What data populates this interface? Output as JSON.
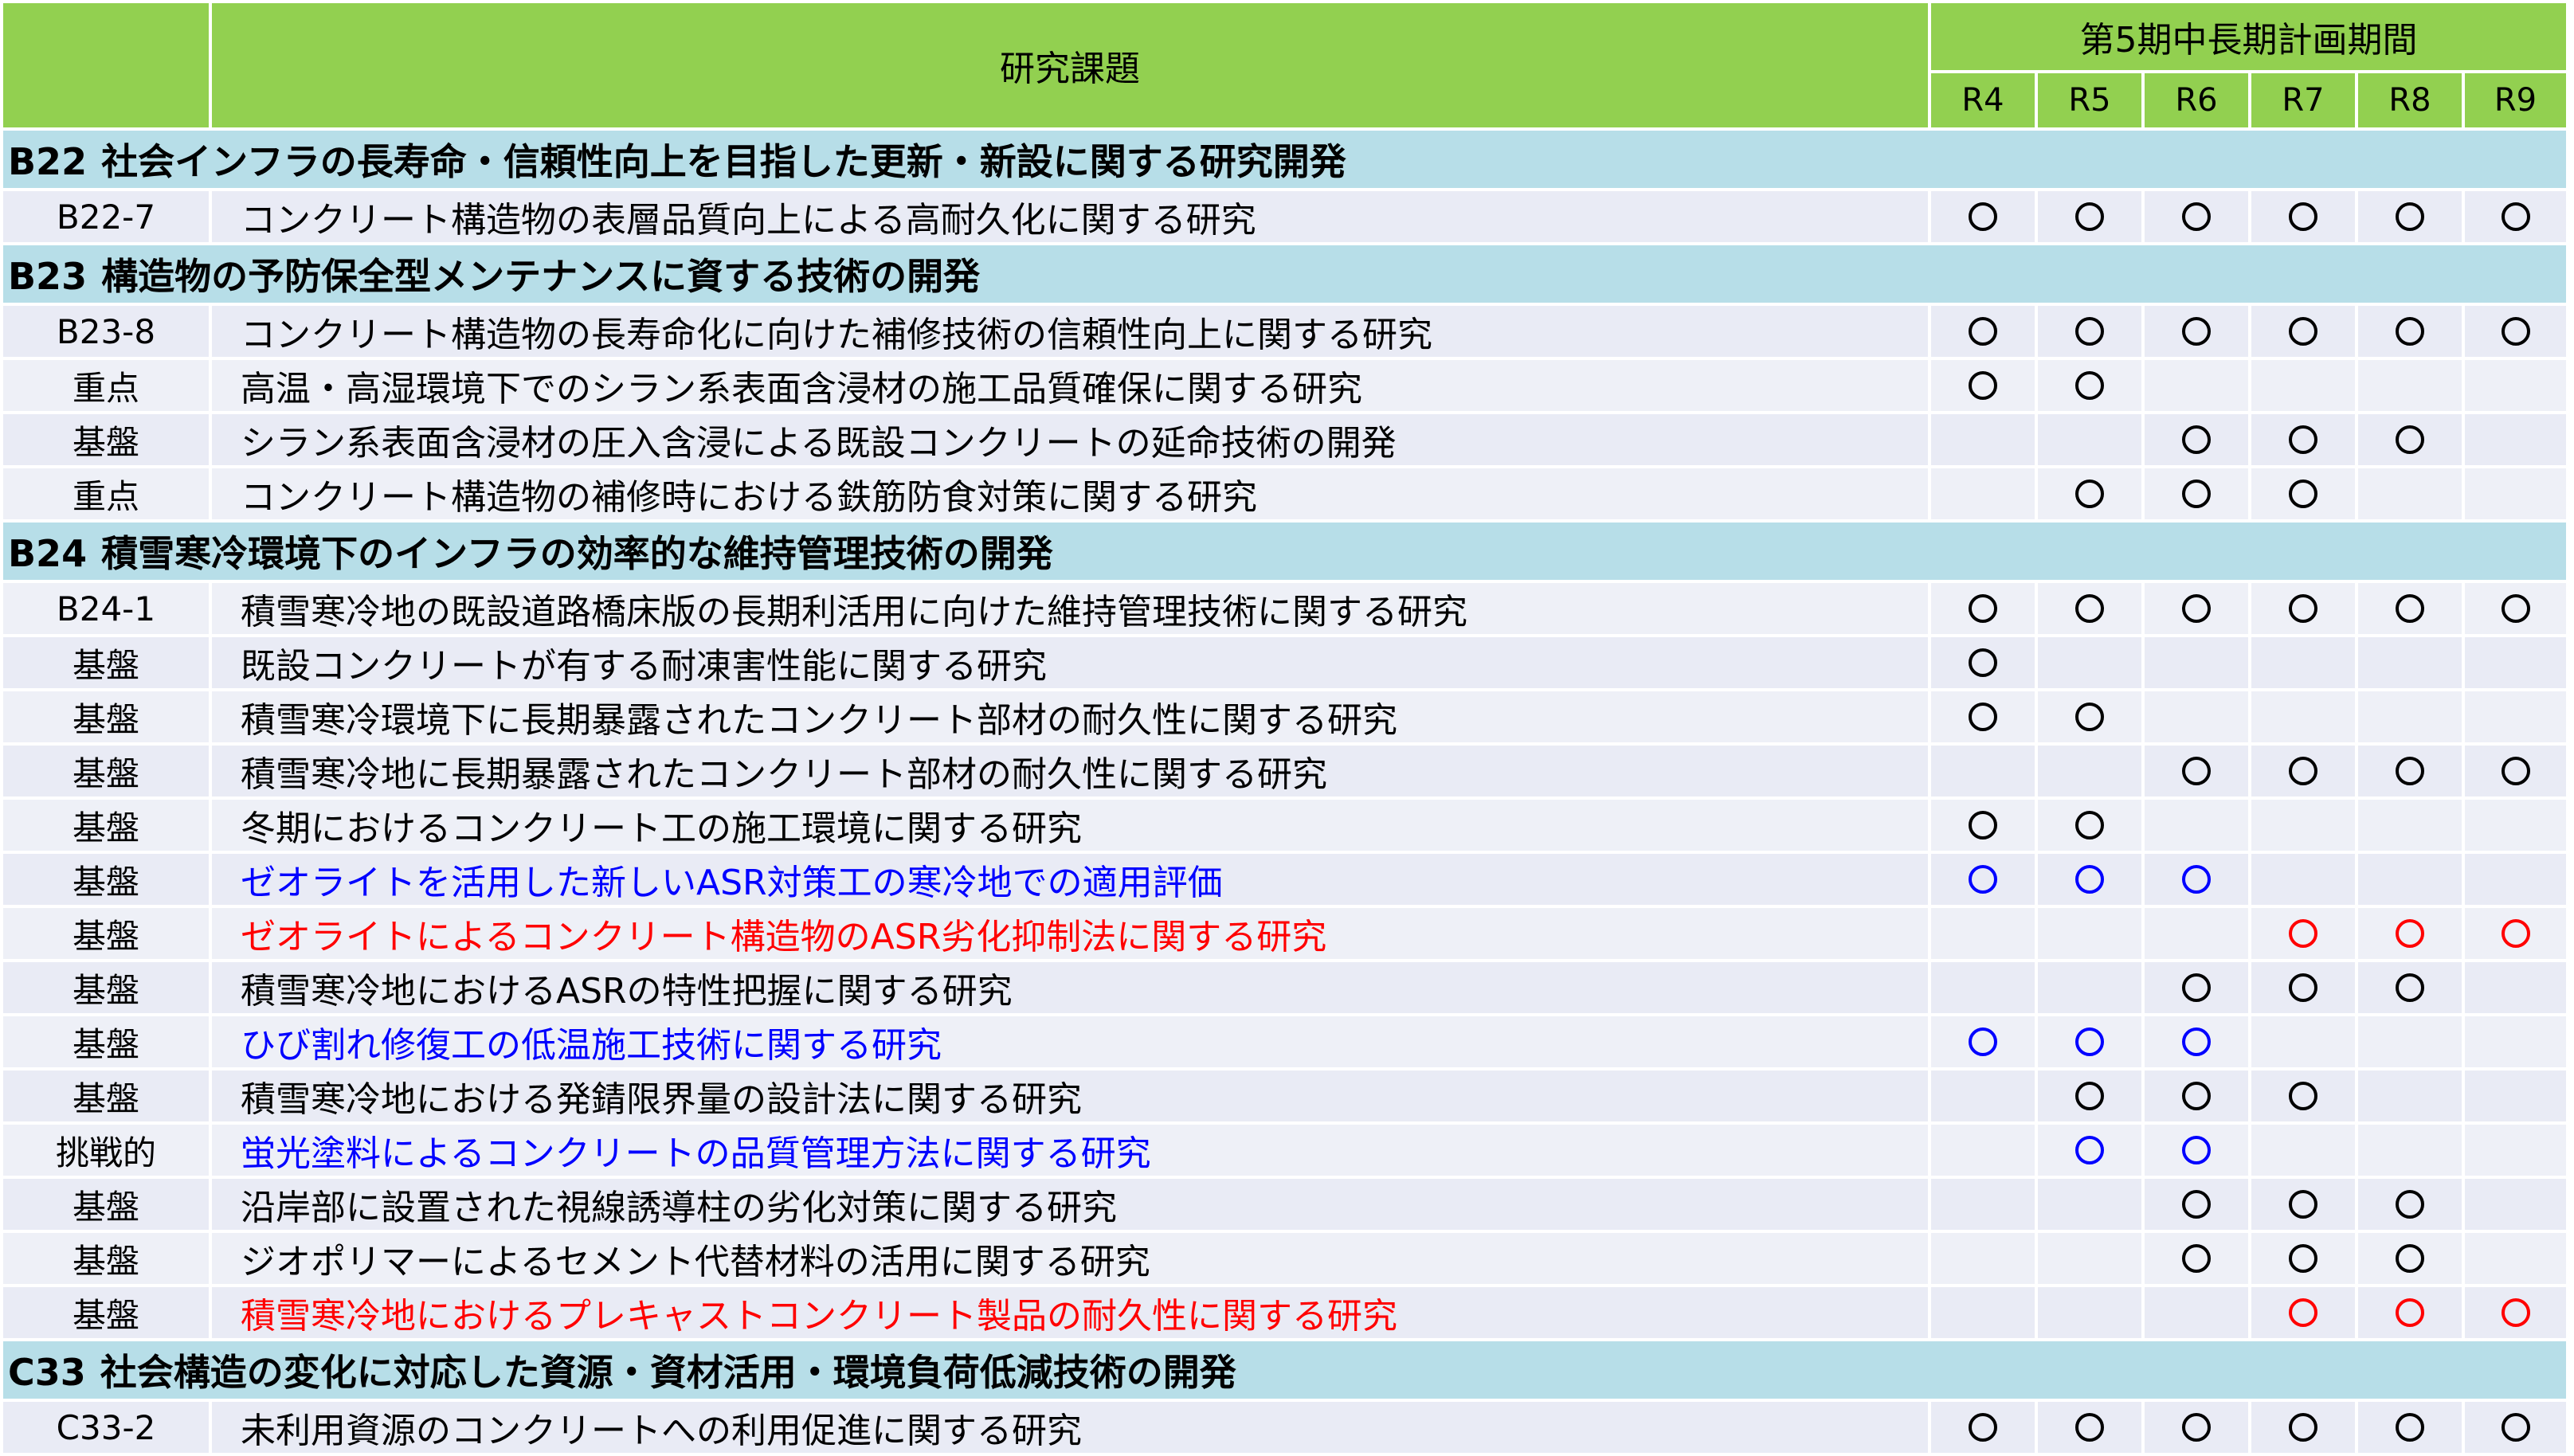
{
  "header": {
    "title": "研究課題",
    "period": "第5期中長期計画期間",
    "years": [
      "R4",
      "R5",
      "R6",
      "R7",
      "R8",
      "R9"
    ]
  },
  "groups": [
    {
      "code": "B22",
      "title": "社会インフラの長寿命・信頼性向上を目指した更新・新設に関する研究開発",
      "rows": [
        {
          "code": "B22-7",
          "title": "コンクリート構造物の表層品質向上による高耐久化に関する研究",
          "color": "black",
          "marks": [
            1,
            1,
            1,
            1,
            1,
            1
          ]
        }
      ]
    },
    {
      "code": "B23",
      "title": "構造物の予防保全型メンテナンスに資する技術の開発",
      "rows": [
        {
          "code": "B23-8",
          "title": "コンクリート構造物の長寿命化に向けた補修技術の信頼性向上に関する研究",
          "color": "black",
          "marks": [
            1,
            1,
            1,
            1,
            1,
            1
          ]
        },
        {
          "code": "重点",
          "title": "高温・高湿環境下でのシラン系表面含浸材の施工品質確保に関する研究",
          "color": "black",
          "marks": [
            1,
            1,
            0,
            0,
            0,
            0
          ]
        },
        {
          "code": "基盤",
          "title": "シラン系表面含浸材の圧入含浸による既設コンクリートの延命技術の開発",
          "color": "black",
          "marks": [
            0,
            0,
            1,
            1,
            1,
            0
          ]
        },
        {
          "code": "重点",
          "title": "コンクリート構造物の補修時における鉄筋防食対策に関する研究",
          "color": "black",
          "marks": [
            0,
            1,
            1,
            1,
            0,
            0
          ]
        }
      ]
    },
    {
      "code": "B24",
      "title": "積雪寒冷環境下のインフラの効率的な維持管理技術の開発",
      "rows": [
        {
          "code": "B24-1",
          "title": "積雪寒冷地の既設道路橋床版の長期利活用に向けた維持管理技術に関する研究",
          "color": "black",
          "marks": [
            1,
            1,
            1,
            1,
            1,
            1
          ]
        },
        {
          "code": "基盤",
          "title": "既設コンクリートが有する耐凍害性能に関する研究",
          "color": "black",
          "marks": [
            1,
            0,
            0,
            0,
            0,
            0
          ]
        },
        {
          "code": "基盤",
          "title": "積雪寒冷環境下に長期暴露されたコンクリート部材の耐久性に関する研究",
          "color": "black",
          "marks": [
            1,
            1,
            0,
            0,
            0,
            0
          ]
        },
        {
          "code": "基盤",
          "title": "積雪寒冷地に長期暴露されたコンクリート部材の耐久性に関する研究",
          "color": "black",
          "marks": [
            0,
            0,
            1,
            1,
            1,
            1
          ]
        },
        {
          "code": "基盤",
          "title": "冬期におけるコンクリート工の施工環境に関する研究",
          "color": "black",
          "marks": [
            1,
            1,
            0,
            0,
            0,
            0
          ]
        },
        {
          "code": "基盤",
          "title": "ゼオライトを活用した新しいASR対策工の寒冷地での適用評価",
          "color": "blue",
          "marks": [
            1,
            1,
            1,
            0,
            0,
            0
          ]
        },
        {
          "code": "基盤",
          "title": "ゼオライトによるコンクリート構造物のASR劣化抑制法に関する研究",
          "color": "red",
          "marks": [
            0,
            0,
            0,
            1,
            1,
            1
          ]
        },
        {
          "code": "基盤",
          "title": "積雪寒冷地におけるASRの特性把握に関する研究",
          "color": "black",
          "marks": [
            0,
            0,
            1,
            1,
            1,
            0
          ]
        },
        {
          "code": "基盤",
          "title": "ひび割れ修復工の低温施工技術に関する研究",
          "color": "blue",
          "marks": [
            1,
            1,
            1,
            0,
            0,
            0
          ]
        },
        {
          "code": "基盤",
          "title": "積雪寒冷地における発錆限界量の設計法に関する研究",
          "color": "black",
          "marks": [
            0,
            1,
            1,
            1,
            0,
            0
          ]
        },
        {
          "code": "挑戦的",
          "title": "蛍光塗料によるコンクリートの品質管理方法に関する研究",
          "color": "blue",
          "marks": [
            0,
            1,
            1,
            0,
            0,
            0
          ]
        },
        {
          "code": "基盤",
          "title": "沿岸部に設置された視線誘導柱の劣化対策に関する研究",
          "color": "black",
          "marks": [
            0,
            0,
            1,
            1,
            1,
            0
          ]
        },
        {
          "code": "基盤",
          "title": "ジオポリマーによるセメント代替材料の活用に関する研究",
          "color": "black",
          "marks": [
            0,
            0,
            1,
            1,
            1,
            0
          ]
        },
        {
          "code": "基盤",
          "title": "積雪寒冷地におけるプレキャストコンクリート製品の耐久性に関する研究",
          "color": "red",
          "marks": [
            0,
            0,
            0,
            1,
            1,
            1
          ]
        }
      ]
    },
    {
      "code": "C33",
      "title": "社会構造の変化に対応した資源・資材活用・環境負荷低減技術の開発",
      "rows": [
        {
          "code": "C33-2",
          "title": "未利用資源のコンクリートへの利用促進に関する研究",
          "color": "black",
          "marks": [
            1,
            1,
            1,
            1,
            1,
            1
          ]
        }
      ]
    }
  ]
}
